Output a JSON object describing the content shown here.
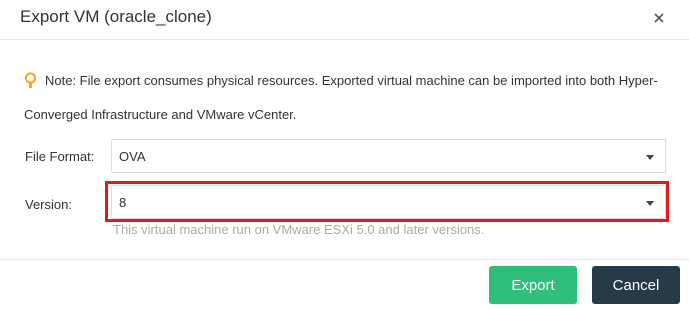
{
  "dialog": {
    "title": "Export VM (oracle_clone)"
  },
  "note": {
    "icon": "lightbulb-icon",
    "text": "Note: File export consumes physical resources. Exported virtual machine can be imported into both Hyper-Converged Infrastructure and VMware vCenter."
  },
  "file_format": {
    "label": "File Format:",
    "value": "OVA"
  },
  "version": {
    "label": "Version:",
    "value": "8",
    "hint": "This virtual machine run on VMware ESXi 5.0 and later versions."
  },
  "buttons": {
    "export_label": "Export",
    "cancel_label": "Cancel"
  },
  "colors": {
    "accent_green": "#2dbf7b",
    "dark_navy": "#263a48",
    "highlight_red": "#e01b1b",
    "note_icon_orange": "#f5a623"
  }
}
